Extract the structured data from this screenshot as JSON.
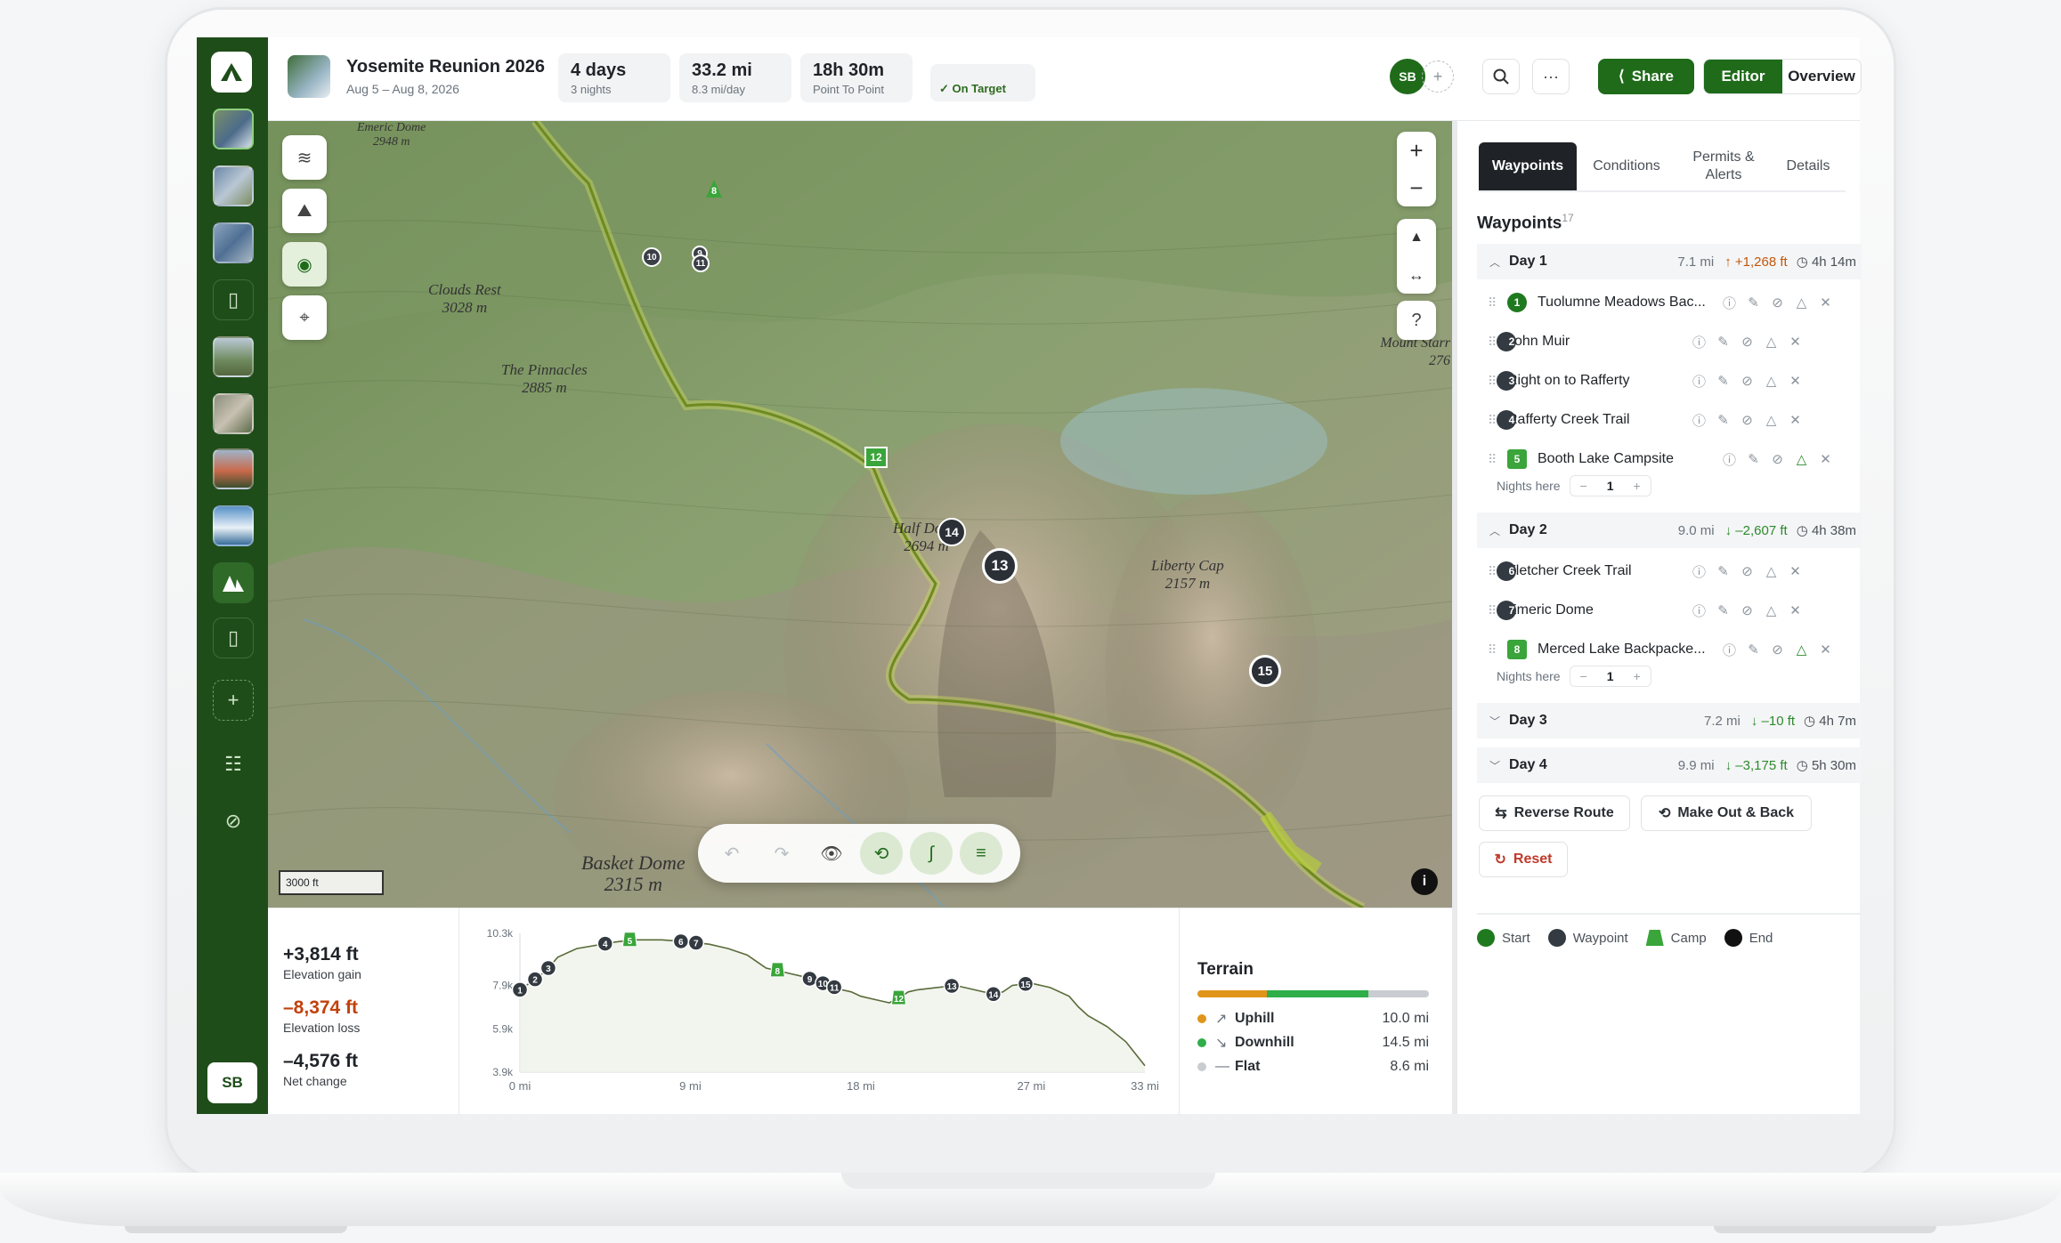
{
  "trip": {
    "title": "Yosemite Reunion 2026",
    "dates": "Aug 5 – Aug 8, 2026"
  },
  "stats": [
    {
      "value": "4 days",
      "sub": "3 nights"
    },
    {
      "value": "33.2 mi",
      "sub": "8.3 mi/day"
    },
    {
      "value": "18h 30m",
      "sub": "Point To Point"
    }
  ],
  "status": "✓ On Target",
  "user": {
    "initials": "SB"
  },
  "header_buttons": {
    "share": "Share",
    "editor": "Editor",
    "overview": "Overview"
  },
  "map": {
    "scale": "3000 ft",
    "labels": [
      {
        "name": "Emeric Dome",
        "elev": "2948 m"
      },
      {
        "name": "Clouds Rest",
        "elev": "3028 m"
      },
      {
        "name": "The Pinnacles",
        "elev": "2885 m"
      },
      {
        "name": "Half Dome",
        "elev": "2694 m"
      },
      {
        "name": "Liberty Cap",
        "elev": "2157 m"
      },
      {
        "name": "Mount Starr",
        "elev": "276"
      },
      {
        "name": "Basket Dome",
        "elev": "2315 m"
      }
    ],
    "markers": [
      "8",
      "10",
      "9",
      "11",
      "12",
      "14",
      "13",
      "15"
    ]
  },
  "elevation": {
    "gain": {
      "value": "+3,814 ft",
      "label": "Elevation gain",
      "color": "#1f2328"
    },
    "loss": {
      "value": "–8,374 ft",
      "label": "Elevation loss",
      "color": "#c2410c"
    },
    "net": {
      "value": "–4,576 ft",
      "label": "Net change",
      "color": "#1f2328"
    }
  },
  "chart_data": {
    "type": "area",
    "title": "",
    "xlabel": "",
    "ylabel": "",
    "x_ticks": [
      "0 mi",
      "9 mi",
      "18 mi",
      "27 mi",
      "33 mi"
    ],
    "y_ticks": [
      "10.3k",
      "7.9k",
      "5.9k",
      "3.9k"
    ],
    "x_range": [
      0,
      33
    ],
    "y_range": [
      3.9,
      10.3
    ],
    "series": [
      {
        "x": [
          0,
          0.5,
          1,
          1.5,
          2,
          3,
          5,
          6,
          7.5,
          9,
          10,
          11,
          12,
          12.5,
          13,
          14,
          15,
          16,
          17,
          17.5,
          18,
          19,
          19.5,
          20,
          20.5,
          21,
          22,
          23,
          24,
          25,
          25.5,
          26,
          27,
          28,
          29,
          29.5,
          30,
          31,
          32,
          33
        ],
        "y": [
          7.7,
          8.0,
          8.3,
          8.7,
          9.2,
          9.6,
          9.9,
          10.0,
          10.0,
          9.9,
          9.8,
          9.6,
          9.3,
          9.0,
          8.7,
          8.5,
          8.3,
          8.0,
          7.7,
          7.6,
          7.4,
          7.2,
          7.1,
          7.3,
          7.6,
          7.7,
          7.8,
          7.9,
          7.7,
          7.5,
          7.6,
          7.9,
          8.0,
          7.8,
          7.4,
          6.9,
          6.5,
          6.0,
          5.3,
          4.2
        ]
      }
    ],
    "markers": [
      {
        "label": "1",
        "mi": 0,
        "type": "wp"
      },
      {
        "label": "2",
        "mi": 0.8,
        "type": "wp"
      },
      {
        "label": "3",
        "mi": 1.5,
        "type": "wp"
      },
      {
        "label": "4",
        "mi": 4.5,
        "type": "wp"
      },
      {
        "label": "5",
        "mi": 5.8,
        "type": "camp"
      },
      {
        "label": "6",
        "mi": 8.5,
        "type": "wp"
      },
      {
        "label": "7",
        "mi": 9.3,
        "type": "wp"
      },
      {
        "label": "8",
        "mi": 13.6,
        "type": "camp"
      },
      {
        "label": "9",
        "mi": 15.3,
        "type": "wp"
      },
      {
        "label": "10",
        "mi": 16.0,
        "type": "wp"
      },
      {
        "label": "11",
        "mi": 16.6,
        "type": "wp"
      },
      {
        "label": "12",
        "mi": 20.0,
        "type": "camp"
      },
      {
        "label": "13",
        "mi": 22.8,
        "type": "wp"
      },
      {
        "label": "14",
        "mi": 25.0,
        "type": "wp"
      },
      {
        "label": "15",
        "mi": 26.7,
        "type": "wp"
      }
    ]
  },
  "terrain": {
    "title": "Terrain",
    "rows": [
      {
        "name": "Uphill",
        "value": "10.0 mi",
        "color": "#e0951a",
        "glyph": "↗"
      },
      {
        "name": "Downhill",
        "value": "14.5 mi",
        "color": "#2fae4a",
        "glyph": "↘"
      },
      {
        "name": "Flat",
        "value": "8.6 mi",
        "color": "#c9ccd0",
        "glyph": "—"
      }
    ],
    "fractions": [
      0.3,
      0.44,
      0.26
    ]
  },
  "tabs": [
    "Waypoints",
    "Conditions",
    "Permits & Alerts",
    "Details"
  ],
  "waypoints": {
    "heading": "Waypoints",
    "count": "17",
    "nights_label": "Nights here",
    "days": [
      {
        "name": "Day 1",
        "mi": "7.1 mi",
        "gain": "↑ +1,268 ft",
        "dir": "up",
        "time": "◷ 4h 14m",
        "expanded": true,
        "items": [
          {
            "n": "1",
            "name": "Tuolumne Meadows Bac...",
            "kind": "start"
          },
          {
            "n": "2",
            "name": "John Muir",
            "kind": "wp"
          },
          {
            "n": "3",
            "name": "Right on to Rafferty",
            "kind": "wp"
          },
          {
            "n": "4",
            "name": "Rafferty Creek Trail",
            "kind": "wp"
          },
          {
            "n": "5",
            "name": "Booth Lake Campsite",
            "kind": "camp"
          }
        ],
        "nights": "1"
      },
      {
        "name": "Day 2",
        "mi": "9.0 mi",
        "gain": "↓ –2,607 ft",
        "dir": "dw",
        "time": "◷ 4h 38m",
        "expanded": true,
        "items": [
          {
            "n": "6",
            "name": "Fletcher Creek Trail",
            "kind": "wp"
          },
          {
            "n": "7",
            "name": "Emeric Dome",
            "kind": "wp"
          },
          {
            "n": "8",
            "name": "Merced Lake Backpacke...",
            "kind": "camp"
          }
        ],
        "nights": "1"
      },
      {
        "name": "Day 3",
        "mi": "7.2 mi",
        "gain": "↓ –10 ft",
        "dir": "dw",
        "time": "◷ 4h 7m",
        "expanded": false
      },
      {
        "name": "Day 4",
        "mi": "9.9 mi",
        "gain": "↓ –3,175 ft",
        "dir": "dw",
        "time": "◷ 5h 30m",
        "expanded": false
      }
    ]
  },
  "actions": {
    "reverse": "Reverse Route",
    "outback": "Make Out & Back",
    "reset": "Reset"
  },
  "legend": [
    {
      "label": "Start",
      "color": "#1f7a1f"
    },
    {
      "label": "Waypoint",
      "color": "#333a41"
    },
    {
      "label": "Camp",
      "color": "#3aa53a"
    },
    {
      "label": "End",
      "color": "#111111"
    }
  ]
}
